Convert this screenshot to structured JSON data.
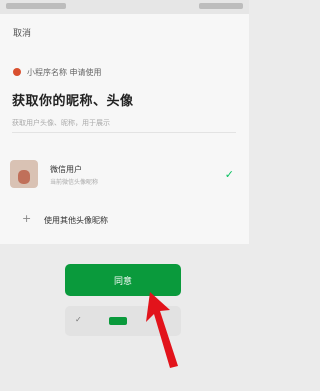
{
  "status_bar": {},
  "dialog": {
    "close_text": "取消",
    "app_name": "小程序名称 申请使用",
    "title": "获取你的昵称、头像",
    "subtitle": "获取用户头像、昵称，用于展示",
    "account": {
      "name": "微信用户",
      "sub": "当前微信头像昵称"
    },
    "new_account_label": "使用其他头像昵称"
  },
  "buttons": {
    "agree_label": "同意"
  },
  "colors": {
    "accent_green": "#0a9a3c",
    "arrow_red": "#e2131b"
  },
  "icons": {
    "check": "check-icon",
    "plus": "plus-icon",
    "arrow": "red-arrow-annotation"
  }
}
